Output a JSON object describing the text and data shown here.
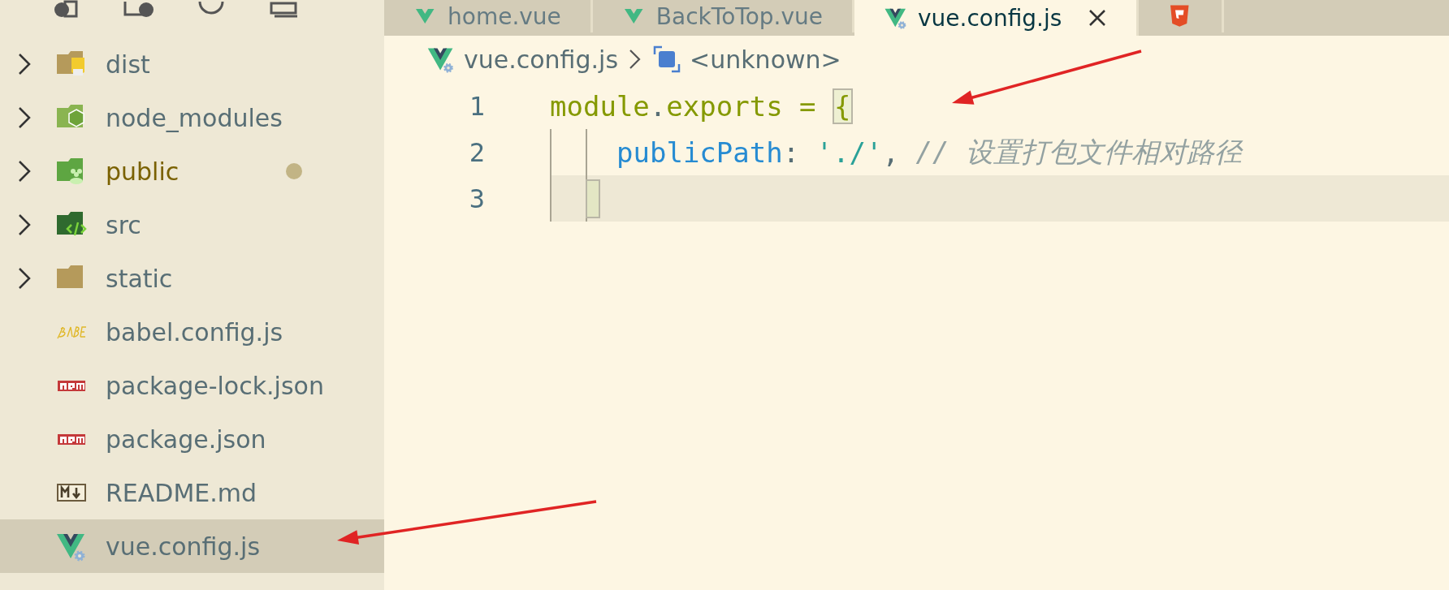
{
  "tabs": [
    {
      "label": "home.vue",
      "selected": false,
      "kind": "vue"
    },
    {
      "label": "BackToTop.vue",
      "selected": false,
      "kind": "vue"
    },
    {
      "label": "vue.config.js",
      "selected": true,
      "kind": "vueconfig"
    },
    {
      "selected": false,
      "kind": "html"
    }
  ],
  "explorer": [
    {
      "name": "dist",
      "kind": "folder",
      "expanded": false,
      "selected": false,
      "modified": false
    },
    {
      "name": "node_modules",
      "kind": "folder",
      "expanded": false,
      "selected": false,
      "modified": false
    },
    {
      "name": "public",
      "kind": "folder",
      "expanded": false,
      "selected": false,
      "modified": true
    },
    {
      "name": "src",
      "kind": "folder",
      "expanded": false,
      "selected": false,
      "modified": false
    },
    {
      "name": "static",
      "kind": "folder",
      "expanded": false,
      "selected": false,
      "modified": false
    },
    {
      "name": "babel.config.js",
      "kind": "file",
      "selected": false,
      "modified": false
    },
    {
      "name": "package-lock.json",
      "kind": "file",
      "selected": false,
      "modified": false
    },
    {
      "name": "package.json",
      "kind": "file",
      "selected": false,
      "modified": false
    },
    {
      "name": "README.md",
      "kind": "file",
      "selected": false,
      "modified": false
    },
    {
      "name": "vue.config.js",
      "kind": "file",
      "selected": true,
      "modified": false
    }
  ],
  "breadcrumb": [
    {
      "label": "vue.config.js",
      "kind": "file"
    },
    {
      "label": "<unknown>",
      "kind": "symbol"
    }
  ],
  "code": [
    {
      "number": "1",
      "indented": false,
      "current": false,
      "tokens": [
        {
          "text": "module",
          "kind": "ident"
        },
        {
          "text": ".",
          "kind": "punct"
        },
        {
          "text": "exports",
          "kind": "ident"
        },
        {
          "text": " = ",
          "kind": "operator"
        },
        {
          "text": "{",
          "kind": "bracket-match"
        }
      ]
    },
    {
      "number": "2",
      "indented": true,
      "current": false,
      "tokens": [
        {
          "text": "publicPath",
          "kind": "property"
        },
        {
          "text": ": ",
          "kind": "punct"
        },
        {
          "text": "'./'",
          "kind": "string"
        },
        {
          "text": ", ",
          "kind": "punct"
        },
        {
          "text": "// 设置打包文件相对路径",
          "kind": "comment"
        }
      ]
    },
    {
      "number": "3",
      "indented": true,
      "current": true
    }
  ]
}
